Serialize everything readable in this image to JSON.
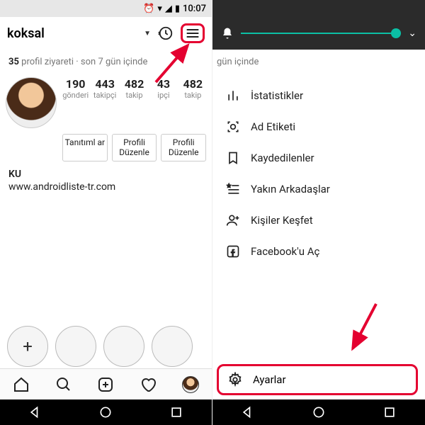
{
  "status": {
    "time": "10:07"
  },
  "left": {
    "username": "koksal",
    "subline_count": "35",
    "subline_text": "profil ziyareti · son 7 gün içinde",
    "stats": [
      {
        "n": "190",
        "l": "gönderi"
      },
      {
        "n": "443",
        "l": "takipçi"
      },
      {
        "n": "482",
        "l": "takip"
      },
      {
        "n": "43",
        "l": "ipçi"
      },
      {
        "n": "482",
        "l": "takip"
      }
    ],
    "buttons": [
      {
        "label": "Tanıtıml ar"
      },
      {
        "label": "Profili Düzenle"
      },
      {
        "label": "Profili Düzenle"
      }
    ],
    "bio_name": "KU",
    "bio_link": "www.androidliste-tr.com"
  },
  "right": {
    "subline_fragment": "gün içinde",
    "menu": [
      {
        "label": "İstatistikler"
      },
      {
        "label": "Ad Etiketi"
      },
      {
        "label": "Kaydedilenler"
      },
      {
        "label": "Yakın Arkadaşlar"
      },
      {
        "label": "Kişiler Keşfet"
      },
      {
        "label": "Facebook'u Aç"
      }
    ],
    "settings": "Ayarlar"
  }
}
